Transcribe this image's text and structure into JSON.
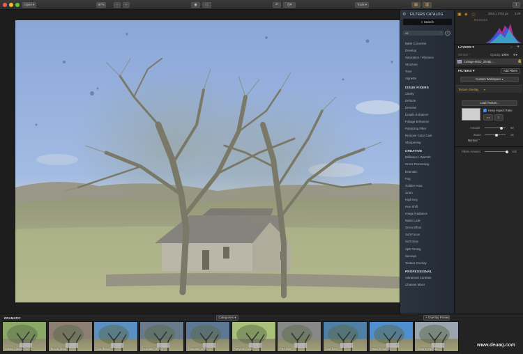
{
  "toolbar": {
    "open_label": "Open",
    "zoom_label": "67%",
    "zoom_minus": "−",
    "zoom_plus": "+",
    "tools_label": "Tools"
  },
  "catalog": {
    "title": "FILTERS CATALOG",
    "search_label": "Search",
    "filter_select": "All",
    "items_top": [
      "B&W Converter",
      "Develop",
      "Saturation / Vibrance",
      "Structure",
      "Tone",
      "Vignette"
    ],
    "section_issue": "ISSUE FIXERS",
    "items_issue": [
      "Clarity",
      "Dehaze",
      "Denoise",
      "Details Enhancer",
      "Foliage Enhancer",
      "Polarizing Filter",
      "Remove Color Cast",
      "Sharpening"
    ],
    "section_creative": "CREATIVE",
    "items_creative": [
      "Brilliance / Warmth",
      "Cross Processing",
      "Dramatic",
      "Fog",
      "Golden Hour",
      "Grain",
      "High Key",
      "Hue Shift",
      "Image Radiance",
      "Matte Look",
      "Orton Effect",
      "Soft Focus",
      "Soft Glow",
      "Split Toning",
      "Sunrays",
      "Texture Overlay"
    ],
    "section_pro": "PROFESSIONAL",
    "items_pro": [
      "Advanced Contrast",
      "Channel Mixer"
    ]
  },
  "right": {
    "dims": "3818 x 2744 px",
    "time": "6:49",
    "rgb": "R:0 G:0 B:0",
    "layers_title": "LAYERS",
    "normal_label": "Normal",
    "opacity_label": "Opacity:",
    "opacity_value": "100%",
    "layer_name": "Cottage-6823_2048p...",
    "filters_title": "FILTERS",
    "add_filters": "Add Filters",
    "workspace": "Custom Workspace",
    "texture_title": "Texture Overlay",
    "load_texture": "Load Texture...",
    "keep_aspect": "Keep Aspect Ratio",
    "amount_label": "Amount",
    "amount_value": "50",
    "zoom_label": "Zoom",
    "zoom_value": "16",
    "blend_label": "Normal",
    "filters_amount_label": "Filters Amount",
    "filters_amount_value": "100"
  },
  "strip": {
    "title": "DRAMATIC",
    "categories": "Categories",
    "overlay_preset": "+ Overlay Preset",
    "presets": [
      {
        "name": "Artistic Classic Strong",
        "tint": "#8aa866"
      },
      {
        "name": "Bloody Mary",
        "tint": "#8c7e73"
      },
      {
        "name": "Cold Mood",
        "tint": "#5a8fc4"
      },
      {
        "name": "Dramatic Strong",
        "tint": "#687a8c"
      },
      {
        "name": "Dramatic Tones",
        "tint": "#5c7896"
      },
      {
        "name": "Fairytale Colors",
        "tint": "#a8c078"
      },
      {
        "name": "Film Noir",
        "tint": "#888888"
      },
      {
        "name": "Lost Soul",
        "tint": "#4e7fa6"
      },
      {
        "name": "Mood Enhancer",
        "tint": "#4f8fd0"
      },
      {
        "name": "Tears in the Rain",
        "tint": "#9aa4ae"
      }
    ]
  },
  "watermark": "www.deuaq.com"
}
